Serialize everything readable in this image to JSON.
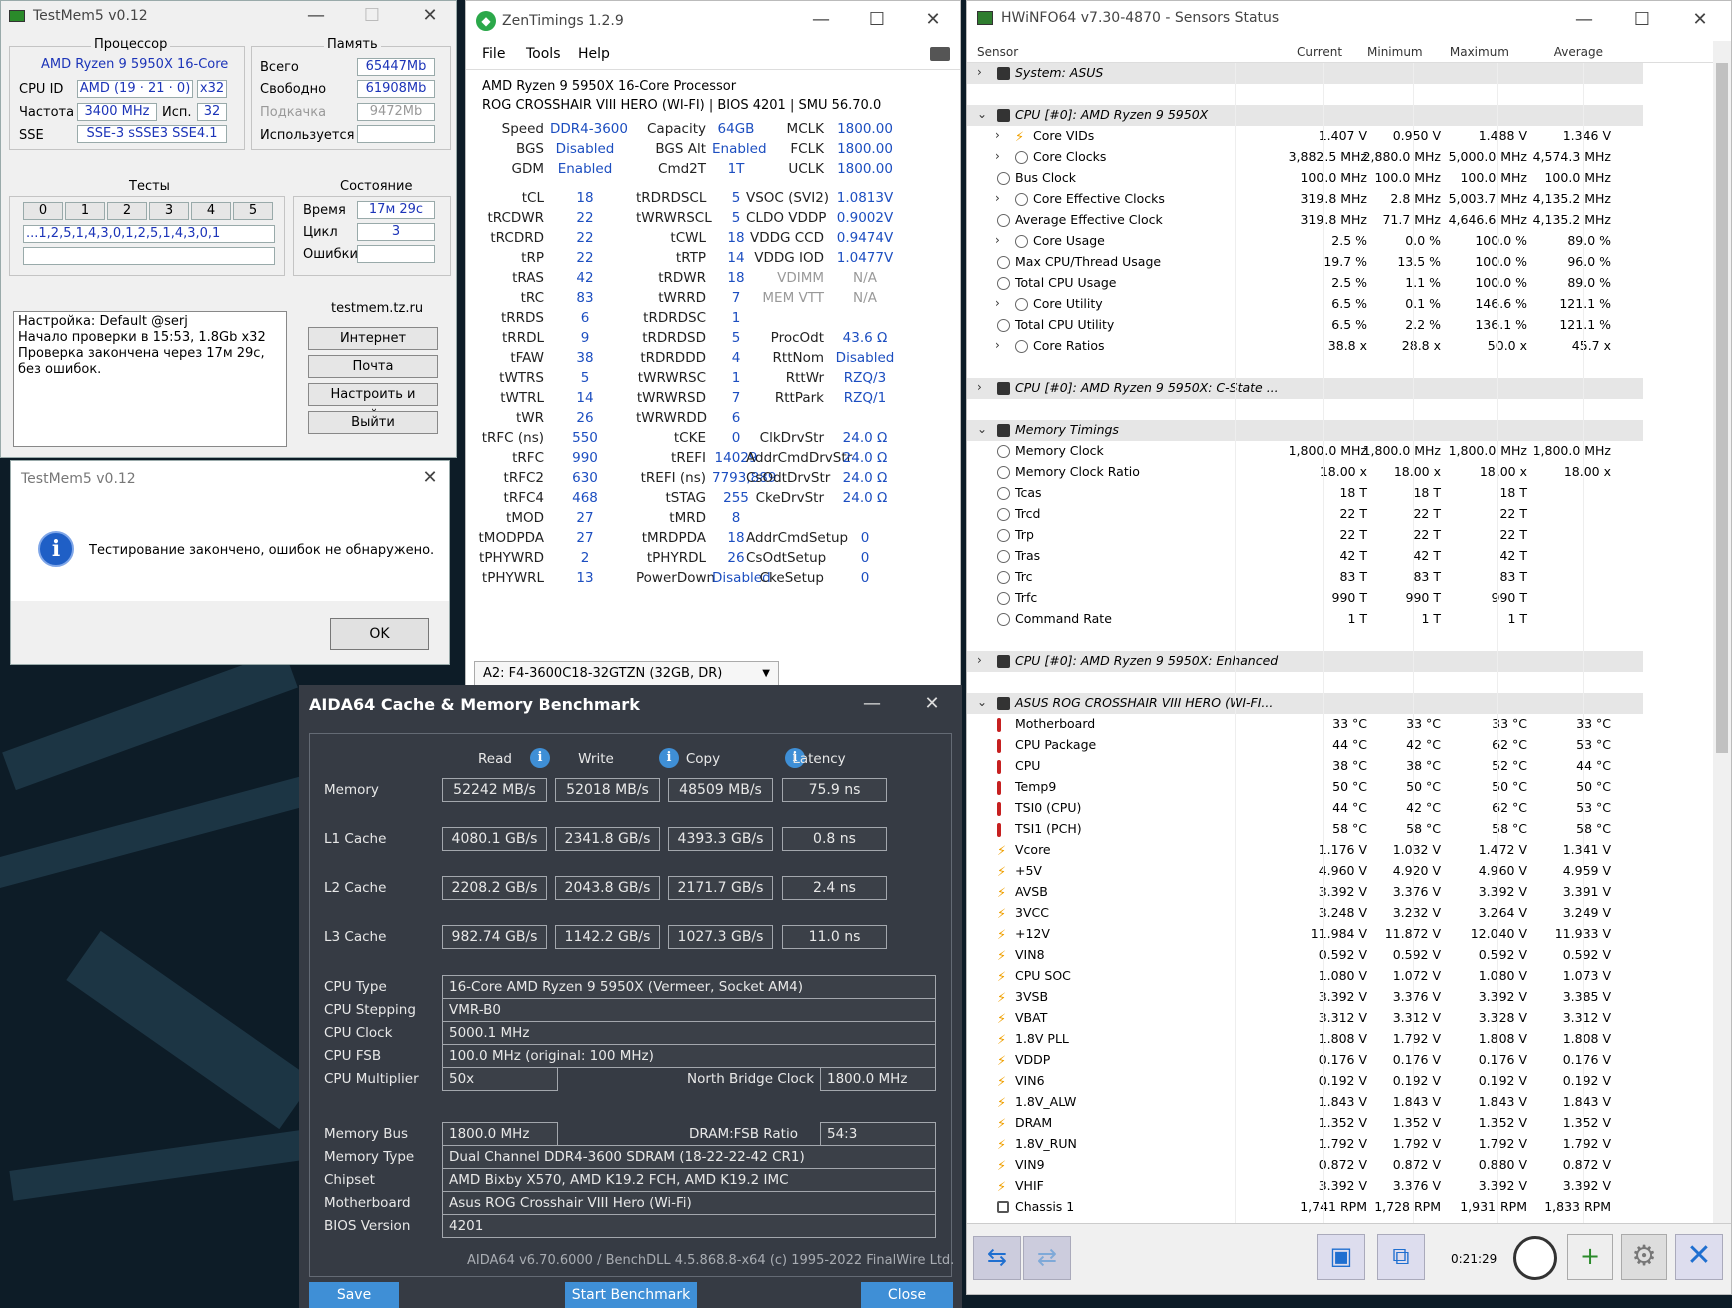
{
  "tm5": {
    "title": "TestMem5 v0.12",
    "proc_title": "Процессор",
    "cpu_name": "AMD Ryzen 9 5950X 16-Core",
    "cpuid_label": "CPU ID",
    "cpuid_value": "AMD (19 · 21 · 0)",
    "cpuid_threads": "x32",
    "freq_label": "Частота",
    "freq_value": "3400 MHz",
    "use_label": "Исп.",
    "use_value": "32",
    "sse_label": "SSE",
    "sse_value": "SSE-3 sSSE3 SSE4.1",
    "mem_title": "Память",
    "total_label": "Всего",
    "total_value": "65447Mb",
    "free_label": "Свободно",
    "free_value": "61908Mb",
    "swap_label": "Подкачка",
    "swap_value": "9472Mb",
    "used_label": "Используется",
    "used_value": "",
    "tests_title": "Тесты",
    "tests": [
      "0",
      "1",
      "2",
      "3",
      "4",
      "5"
    ],
    "sequence": "...1,2,5,1,4,3,0,1,2,5,1,4,3,0,1",
    "state_title": "Состояние",
    "time_label": "Время",
    "time_value": "17м 29с",
    "cycle_label": "Цикл",
    "cycle_value": "3",
    "errors_label": "Ошибки",
    "errors_value": "",
    "log": [
      "Настройка: Default @serj",
      "Начало проверки в 15:53, 1.8Gb x32",
      "Проверка закончена через 17м 29с,",
      "без ошибок."
    ],
    "site": "testmem.tz.ru",
    "buttons": [
      "Интернет",
      "Почта",
      "Настроить и выйти",
      "Выйти"
    ]
  },
  "dialog": {
    "title": "TestMem5 v0.12",
    "message": "Тестирование закончено, ошибок не обнаружено.",
    "ok": "OK"
  },
  "zt": {
    "title": "ZenTimings 1.2.9",
    "menu": [
      "File",
      "Tools",
      "Help"
    ],
    "cpu": "AMD Ryzen 9 5950X 16-Core Processor",
    "board": "ROG CROSSHAIR VIII HERO (WI-FI) | BIOS 4201 | SMU 56.70.0",
    "top": [
      [
        "Speed",
        "DDR4-3600",
        "Capacity",
        "64GB",
        "MCLK",
        "1800.00"
      ],
      [
        "BGS",
        "Disabled",
        "BGS Alt",
        "Enabled",
        "FCLK",
        "1800.00"
      ],
      [
        "GDM",
        "Enabled",
        "Cmd2T",
        "1T",
        "UCLK",
        "1800.00"
      ]
    ],
    "rows": [
      [
        "tCL",
        "18",
        "tRDRDSCL",
        "5",
        "VSOC (SVI2)",
        "1.0813V"
      ],
      [
        "tRCDWR",
        "22",
        "tWRWRSCL",
        "5",
        "CLDO VDDP",
        "0.9002V"
      ],
      [
        "tRCDRD",
        "22",
        "tCWL",
        "18",
        "VDDG CCD",
        "0.9474V"
      ],
      [
        "tRP",
        "22",
        "tRTP",
        "14",
        "VDDG IOD",
        "1.0477V"
      ],
      [
        "tRAS",
        "42",
        "tRDWR",
        "18",
        "VDIMM",
        "N/A"
      ],
      [
        "tRC",
        "83",
        "tWRRD",
        "7",
        "MEM VTT",
        "N/A"
      ],
      [
        "tRRDS",
        "6",
        "tRDRDSC",
        "1",
        "",
        ""
      ],
      [
        "tRRDL",
        "9",
        "tRDRDSD",
        "5",
        "ProcOdt",
        "43.6 Ω"
      ],
      [
        "tFAW",
        "38",
        "tRDRDDD",
        "4",
        "RttNom",
        "Disabled"
      ],
      [
        "tWTRS",
        "5",
        "tWRWRSC",
        "1",
        "RttWr",
        "RZQ/3"
      ],
      [
        "tWTRL",
        "14",
        "tWRWRSD",
        "7",
        "RttPark",
        "RZQ/1"
      ],
      [
        "tWR",
        "26",
        "tWRWRDD",
        "6",
        "",
        ""
      ],
      [
        "tRFC (ns)",
        "550",
        "tCKE",
        "0",
        "ClkDrvStr",
        "24.0 Ω"
      ],
      [
        "tRFC",
        "990",
        "tREFI",
        "14029",
        "AddrCmdDrvStr",
        "24.0 Ω"
      ],
      [
        "tRFC2",
        "630",
        "tREFI (ns)",
        "7793,889",
        "CsOdtDrvStr",
        "24.0 Ω"
      ],
      [
        "tRFC4",
        "468",
        "tSTAG",
        "255",
        "CkeDrvStr",
        "24.0 Ω"
      ],
      [
        "tMOD",
        "27",
        "tMRD",
        "8",
        "",
        ""
      ],
      [
        "tMODPDA",
        "27",
        "tMRDPDA",
        "18",
        "AddrCmdSetup",
        "0"
      ],
      [
        "tPHYWRD",
        "2",
        "tPHYRDL",
        "26",
        "CsOdtSetup",
        "0"
      ],
      [
        "tPHYWRL",
        "13",
        "PowerDown",
        "Disabled",
        "CkeSetup",
        "0"
      ]
    ],
    "dimm": "A2: F4-3600C18-32GTZN (32GB, DR)"
  },
  "hw": {
    "title": "HWiNFO64 v7.30-4870 - Sensors Status",
    "cols": [
      "Sensor",
      "Current",
      "Minimum",
      "Maximum",
      "Average"
    ],
    "timer": "0:21:29",
    "rows": [
      [
        "g",
        "e",
        "System: ASUS",
        "",
        "",
        "",
        ""
      ],
      [
        "s",
        "",
        "",
        "",
        "",
        "",
        ""
      ],
      [
        "g",
        "o",
        "CPU [#0]: AMD Ryzen 9 5950X",
        "",
        "",
        "",
        ""
      ],
      [
        "v",
        "e",
        "Core VIDs",
        "1.407 V",
        "0.950 V",
        "1.488 V",
        "1.346 V"
      ],
      [
        "c",
        "e",
        "Core Clocks",
        "3,882.5 MHz",
        "2,880.0 MHz",
        "5,000.0 MHz",
        "4,574.3 MHz"
      ],
      [
        "c",
        "",
        "Bus Clock",
        "100.0 MHz",
        "100.0 MHz",
        "100.0 MHz",
        "100.0 MHz"
      ],
      [
        "c",
        "e",
        "Core Effective Clocks",
        "319.8 MHz",
        "2.8 MHz",
        "5,003.7 MHz",
        "4,135.2 MHz"
      ],
      [
        "c",
        "",
        "Average Effective Clock",
        "319.8 MHz",
        "71.7 MHz",
        "4,646.6 MHz",
        "4,135.2 MHz"
      ],
      [
        "c",
        "e",
        "Core Usage",
        "2.5 %",
        "0.0 %",
        "100.0 %",
        "89.0 %"
      ],
      [
        "c",
        "",
        "Max CPU/Thread Usage",
        "19.7 %",
        "13.5 %",
        "100.0 %",
        "96.0 %"
      ],
      [
        "c",
        "",
        "Total CPU Usage",
        "2.5 %",
        "1.1 %",
        "100.0 %",
        "89.0 %"
      ],
      [
        "c",
        "e",
        "Core Utility",
        "6.5 %",
        "0.1 %",
        "146.6 %",
        "121.1 %"
      ],
      [
        "c",
        "",
        "Total CPU Utility",
        "6.5 %",
        "2.2 %",
        "136.1 %",
        "121.1 %"
      ],
      [
        "c",
        "e",
        "Core Ratios",
        "38.8 x",
        "28.8 x",
        "50.0 x",
        "45.7 x"
      ],
      [
        "s",
        "",
        "",
        "",
        "",
        "",
        ""
      ],
      [
        "g",
        "e",
        "CPU [#0]: AMD Ryzen 9 5950X: C-State ...",
        "",
        "",
        "",
        ""
      ],
      [
        "s",
        "",
        "",
        "",
        "",
        "",
        ""
      ],
      [
        "g",
        "o",
        "Memory Timings",
        "",
        "",
        "",
        ""
      ],
      [
        "c",
        "",
        "Memory Clock",
        "1,800.0 MHz",
        "1,800.0 MHz",
        "1,800.0 MHz",
        "1,800.0 MHz"
      ],
      [
        "c",
        "",
        "Memory Clock Ratio",
        "18.00 x",
        "18.00 x",
        "18.00 x",
        "18.00 x"
      ],
      [
        "c",
        "",
        "Tcas",
        "18 T",
        "18 T",
        "18 T",
        ""
      ],
      [
        "c",
        "",
        "Trcd",
        "22 T",
        "22 T",
        "22 T",
        ""
      ],
      [
        "c",
        "",
        "Trp",
        "22 T",
        "22 T",
        "22 T",
        ""
      ],
      [
        "c",
        "",
        "Tras",
        "42 T",
        "42 T",
        "42 T",
        ""
      ],
      [
        "c",
        "",
        "Trc",
        "83 T",
        "83 T",
        "83 T",
        ""
      ],
      [
        "c",
        "",
        "Trfc",
        "990 T",
        "990 T",
        "990 T",
        ""
      ],
      [
        "c",
        "",
        "Command Rate",
        "1 T",
        "1 T",
        "1 T",
        ""
      ],
      [
        "s",
        "",
        "",
        "",
        "",
        "",
        ""
      ],
      [
        "g",
        "e",
        "CPU [#0]: AMD Ryzen 9 5950X: Enhanced",
        "",
        "",
        "",
        ""
      ],
      [
        "s",
        "",
        "",
        "",
        "",
        "",
        ""
      ],
      [
        "g",
        "o",
        "ASUS ROG CROSSHAIR VIII HERO (WI-FI...",
        "",
        "",
        "",
        ""
      ],
      [
        "t",
        "",
        "Motherboard",
        "33 °C",
        "33 °C",
        "33 °C",
        "33 °C"
      ],
      [
        "t",
        "",
        "CPU Package",
        "44 °C",
        "42 °C",
        "62 °C",
        "53 °C"
      ],
      [
        "t",
        "",
        "CPU",
        "38 °C",
        "38 °C",
        "52 °C",
        "44 °C"
      ],
      [
        "t",
        "",
        "Temp9",
        "50 °C",
        "50 °C",
        "50 °C",
        "50 °C"
      ],
      [
        "t",
        "",
        "TSI0 (CPU)",
        "44 °C",
        "42 °C",
        "62 °C",
        "53 °C"
      ],
      [
        "t",
        "",
        "TSI1 (PCH)",
        "58 °C",
        "58 °C",
        "58 °C",
        "58 °C"
      ],
      [
        "v",
        "",
        "Vcore",
        "1.176 V",
        "1.032 V",
        "1.472 V",
        "1.341 V"
      ],
      [
        "v",
        "",
        "+5V",
        "4.960 V",
        "4.920 V",
        "4.960 V",
        "4.959 V"
      ],
      [
        "v",
        "",
        "AVSB",
        "3.392 V",
        "3.376 V",
        "3.392 V",
        "3.391 V"
      ],
      [
        "v",
        "",
        "3VCC",
        "3.248 V",
        "3.232 V",
        "3.264 V",
        "3.249 V"
      ],
      [
        "v",
        "",
        "+12V",
        "11.984 V",
        "11.872 V",
        "12.040 V",
        "11.933 V"
      ],
      [
        "v",
        "",
        "VIN8",
        "0.592 V",
        "0.592 V",
        "0.592 V",
        "0.592 V"
      ],
      [
        "v",
        "",
        "CPU SOC",
        "1.080 V",
        "1.072 V",
        "1.080 V",
        "1.073 V"
      ],
      [
        "v",
        "",
        "3VSB",
        "3.392 V",
        "3.376 V",
        "3.392 V",
        "3.385 V"
      ],
      [
        "v",
        "",
        "VBAT",
        "3.312 V",
        "3.312 V",
        "3.328 V",
        "3.312 V"
      ],
      [
        "v",
        "",
        "1.8V PLL",
        "1.808 V",
        "1.792 V",
        "1.808 V",
        "1.808 V"
      ],
      [
        "v",
        "",
        "VDDP",
        "0.176 V",
        "0.176 V",
        "0.176 V",
        "0.176 V"
      ],
      [
        "v",
        "",
        "VIN6",
        "0.192 V",
        "0.192 V",
        "0.192 V",
        "0.192 V"
      ],
      [
        "v",
        "",
        "1.8V_ALW",
        "1.843 V",
        "1.843 V",
        "1.843 V",
        "1.843 V"
      ],
      [
        "v",
        "",
        "DRAM",
        "1.352 V",
        "1.352 V",
        "1.352 V",
        "1.352 V"
      ],
      [
        "v",
        "",
        "1.8V_RUN",
        "1.792 V",
        "1.792 V",
        "1.792 V",
        "1.792 V"
      ],
      [
        "v",
        "",
        "VIN9",
        "0.872 V",
        "0.872 V",
        "0.880 V",
        "0.872 V"
      ],
      [
        "v",
        "",
        "VHIF",
        "3.392 V",
        "3.376 V",
        "3.392 V",
        "3.392 V"
      ],
      [
        "f",
        "",
        "Chassis 1",
        "1,741 RPM",
        "1,728 RPM",
        "1,931 RPM",
        "1,833 RPM"
      ]
    ]
  },
  "aida": {
    "title": "AIDA64 Cache & Memory Benchmark",
    "headers": [
      "Read",
      "Write",
      "Copy",
      "Latency"
    ],
    "bench": [
      [
        "Memory",
        "52242 MB/s",
        "52018 MB/s",
        "48509 MB/s",
        "75.9 ns"
      ],
      [
        "L1 Cache",
        "4080.1 GB/s",
        "2341.8 GB/s",
        "4393.3 GB/s",
        "0.8 ns"
      ],
      [
        "L2 Cache",
        "2208.2 GB/s",
        "2043.8 GB/s",
        "2171.7 GB/s",
        "2.4 ns"
      ],
      [
        "L3 Cache",
        "982.74 GB/s",
        "1142.2 GB/s",
        "1027.3 GB/s",
        "11.0 ns"
      ]
    ],
    "cpu_type_label": "CPU Type",
    "cpu_type": "16-Core AMD Ryzen 9 5950X  (Vermeer, Socket AM4)",
    "stepping_label": "CPU Stepping",
    "stepping": "VMR-B0",
    "clock_label": "CPU Clock",
    "clock": "5000.1 MHz",
    "fsb_label": "CPU FSB",
    "fsb": "100.0 MHz  (original: 100 MHz)",
    "mult_label": "CPU Multiplier",
    "mult": "50x",
    "nb_label": "North Bridge Clock",
    "nb": "1800.0 MHz",
    "membus_label": "Memory Bus",
    "membus": "1800.0 MHz",
    "ratio_label": "DRAM:FSB Ratio",
    "ratio": "54:3",
    "memtype_label": "Memory Type",
    "memtype": "Dual Channel DDR4-3600 SDRAM  (18-22-22-42 CR1)",
    "chipset_label": "Chipset",
    "chipset": "AMD Bixby X570, AMD K19.2 FCH, AMD K19.2 IMC",
    "mb_label": "Motherboard",
    "mb": "Asus ROG Crosshair VIII Hero (Wi-Fi)",
    "bios_label": "BIOS Version",
    "bios": "4201",
    "footer": "AIDA64 v6.70.6000 / BenchDLL 4.5.868.8-x64  (c) 1995-2022 FinalWire Ltd.",
    "save": "Save",
    "start": "Start Benchmark",
    "close": "Close"
  },
  "colors": {
    "blue_text": "#1c34b8",
    "zt_value": "#1c4ec0",
    "aida_bg": "#363b44",
    "aida_button": "#3f8fd6",
    "desktop": "#0d1c27"
  }
}
